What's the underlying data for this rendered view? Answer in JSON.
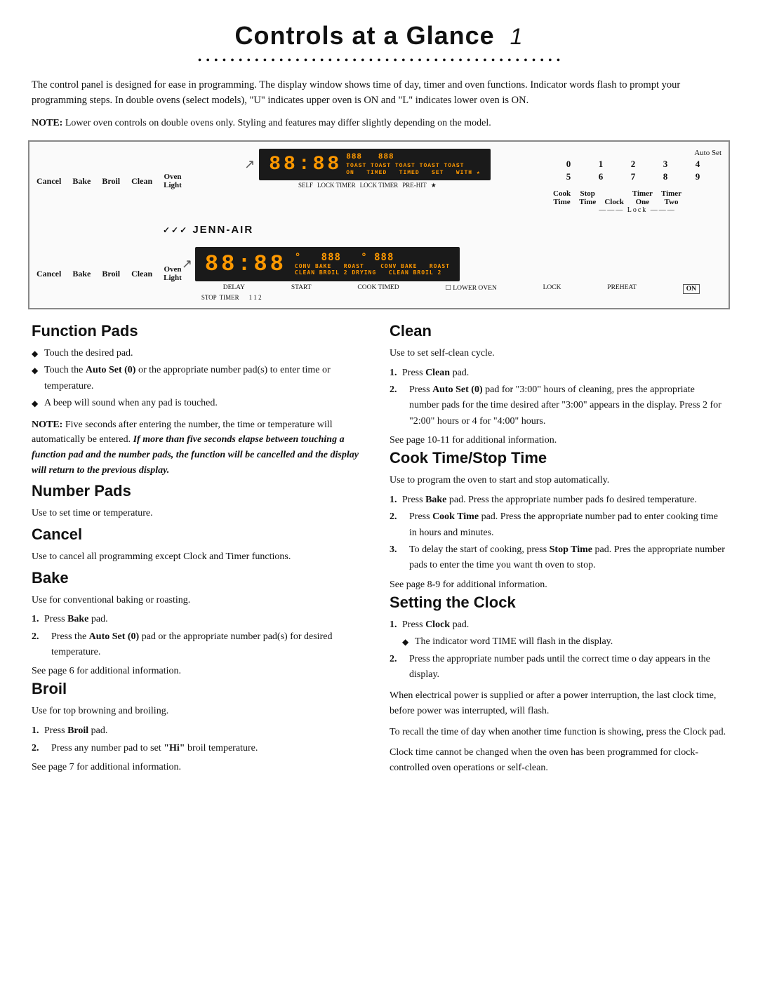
{
  "page": {
    "title": "Controls at a Glance",
    "page_number": "1",
    "intro": "The control panel is designed for ease in programming. The display window shows time of day, timer and oven functions. Indicator words flash to prompt your programming steps. In double ovens (select models), \"U\" indicates upper oven is ON and \"L\" indicates lower oven is ON.",
    "note": "NOTE: Lower oven controls on double ovens only. Styling and features may differ slightly depending on the model."
  },
  "diagram": {
    "row1_labels": [
      "Cancel",
      "Bake",
      "Broil",
      "Clean",
      "Oven\nLight"
    ],
    "row1_display": "88:88",
    "row1_segments": "888  888",
    "brand": "✓✓✓JENN-AIR",
    "row2_labels": [
      "Cancel",
      "Bake",
      "Broil",
      "Clean",
      "Oven\nLight"
    ],
    "autoset_label": "Auto Set",
    "numpad_row1": [
      "0",
      "1",
      "2",
      "3",
      "4"
    ],
    "numpad_row2": [
      "5",
      "6",
      "7",
      "8",
      "9"
    ],
    "func_labels": [
      "Cook\nTime",
      "Stop\nTime",
      "Clock",
      "Timer\nOne",
      "Timer\nTwo"
    ],
    "lock_label": "——— Lock ———",
    "row2_display": "88:88",
    "row2_segments1": "888",
    "row2_segments2": "888",
    "row2_indicators_top": [
      "CONV BAKE ROAST",
      "CONV BAKE ROAST"
    ],
    "row2_indicators_bot": [
      "CLEAN BROIL 2",
      "CLEAN BROIL 2"
    ],
    "bottom_labels": [
      "DELAY",
      "START",
      "COOK TIMED",
      "DRYING",
      "CLEAN BROIL 2",
      "LOCK",
      "PREHEAT"
    ],
    "bottom_btn": "ON"
  },
  "sections": {
    "function_pads": {
      "title": "Function Pads",
      "bullets": [
        "Touch the desired pad.",
        "Touch the Auto Set (0) or the appropriate number pad(s) to enter time or temperature.",
        "A beep will sound when any pad is touched."
      ],
      "note_prefix": "NOTE:",
      "note_body": "Five seconds after entering the number, the time or temperature will be automatically be entered.",
      "italic_text": "If more than five seconds elapse between touching a function pad and the number pads, the function will be cancelled and the display will return to the previous display."
    },
    "number_pads": {
      "title": "Number Pads",
      "body": "Use to set time or temperature."
    },
    "cancel": {
      "title": "Cancel",
      "body": "Use to cancel all programming except Clock and Timer functions."
    },
    "bake": {
      "title": "Bake",
      "body": "Use for conventional baking or roasting.",
      "steps": [
        "Press Bake pad.",
        "Press the Auto Set (0) pad or the appropriate number pad(s) for desired temperature."
      ],
      "see_page": "See page 6 for additional information."
    },
    "broil": {
      "title": "Broil",
      "body": "Use for top browning and broiling.",
      "steps": [
        "Press Broil pad.",
        "Press any number pad to set \"Hi\" broil temperature."
      ],
      "see_page": "See page 7 for additional information."
    },
    "clean": {
      "title": "Clean",
      "body": "Use to set self-clean cycle.",
      "steps": [
        "Press Clean pad.",
        "Press Auto Set (0) pad for \"3:00\" hours of cleaning, press the appropriate number pads for the time desired after \"3:00\" appears in the display. Press 2 for \"2:00\" hours or 4 for \"4:00\" hours."
      ],
      "see_page": "See page 10-11 for additional information."
    },
    "cook_time": {
      "title": "Cook Time/Stop Time",
      "body": "Use to program the oven to start and stop automatically.",
      "steps": [
        "Press Bake pad.  Press the appropriate number pads for desired temperature.",
        "Press Cook Time pad.  Press the appropriate number pads to enter cooking time in hours and minutes.",
        "To delay the start of cooking, press Stop Time pad.  Press the appropriate number pads to enter the time you want the oven to stop."
      ],
      "see_page": "See page 8-9 for additional information."
    },
    "setting_clock": {
      "title": "Setting the Clock",
      "steps_pre": [
        "Press Clock pad.",
        "The indicator word TIME will flash in the display.",
        "Press the appropriate number pads until the correct time of day appears in the display."
      ],
      "body2": "When electrical power is supplied or after a power interruption, the last clock time, before power was interrupted, will flash.",
      "body3": "To recall the time of day when another time function is showing, press the Clock pad.",
      "body4": "Clock time cannot be changed when the oven has been programmed for clock-controlled oven operations or self-clean."
    }
  },
  "icons": {
    "bullet": "◆",
    "check": "✓"
  }
}
